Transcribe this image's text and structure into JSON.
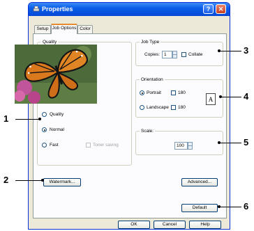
{
  "window": {
    "title": "Properties",
    "help_label": "?",
    "close_label": "✕"
  },
  "tabs": [
    {
      "label": "Setup",
      "active": false
    },
    {
      "label": "Job Options",
      "active": true
    },
    {
      "label": "Color",
      "active": false
    }
  ],
  "quality": {
    "legend": "Quality",
    "options": [
      {
        "label": "Quality",
        "selected": false
      },
      {
        "label": "Normal",
        "selected": true
      },
      {
        "label": "Fast",
        "selected": false
      }
    ],
    "toner_saving_label": "Toner saving"
  },
  "job_type": {
    "legend": "Job Type",
    "copies_label": "Copies:",
    "copies_value": "1",
    "collate_label": "Collate"
  },
  "orientation": {
    "legend": "Orientation",
    "portrait_label": "Portrait",
    "landscape_label": "Landscape",
    "rotate_label": "180",
    "preview_glyph": "A"
  },
  "scale": {
    "legend": "Scale:",
    "value": "100"
  },
  "buttons": {
    "watermark": "Watermark...",
    "advanced": "Advanced...",
    "default": "Default",
    "ok": "OK",
    "cancel": "Cancel",
    "help": "Help"
  },
  "callouts": [
    "1",
    "2",
    "3",
    "4",
    "5",
    "6"
  ]
}
